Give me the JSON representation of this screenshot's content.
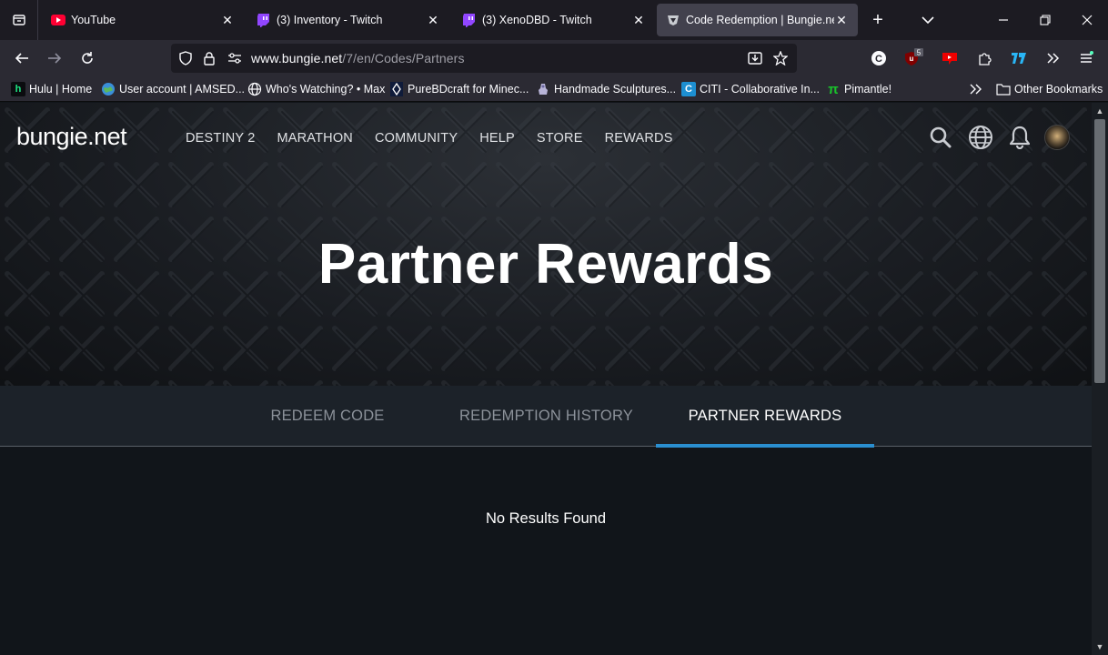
{
  "browser": {
    "tabs": [
      {
        "title": "YouTube",
        "icon": "youtube-icon",
        "active": false
      },
      {
        "title": "(3) Inventory - Twitch",
        "icon": "twitch-icon",
        "active": false
      },
      {
        "title": "(3) XenoDBD - Twitch",
        "icon": "twitch-icon",
        "active": false
      },
      {
        "title": "Code Redemption | Bungie.net",
        "icon": "bungie-icon",
        "active": true
      }
    ],
    "close_glyph": "✕",
    "new_tab_glyph": "+",
    "url_host": "www.bungie.net",
    "url_path": "/7/en/Codes/Partners",
    "extension_badge": "5",
    "bookmarks": [
      {
        "label": "Hulu | Home",
        "icon": "h"
      },
      {
        "label": "User account | AMSED...",
        "icon": ""
      },
      {
        "label": "Who's Watching? • Max",
        "icon": ""
      },
      {
        "label": "PureBDcraft for Minec...",
        "icon": ""
      },
      {
        "label": "Handmade Sculptures...",
        "icon": ""
      },
      {
        "label": "CITI - Collaborative In...",
        "icon": "C"
      },
      {
        "label": "Pimantle!",
        "icon": "π"
      }
    ],
    "other_bookmarks": "Other Bookmarks"
  },
  "site": {
    "logo": "bungie.net",
    "nav": [
      "DESTINY 2",
      "MARATHON",
      "COMMUNITY",
      "HELP",
      "STORE",
      "REWARDS"
    ],
    "hero_title": "Partner Rewards",
    "tabs": [
      {
        "label": "REDEEM CODE",
        "active": false
      },
      {
        "label": "REDEMPTION HISTORY",
        "active": false
      },
      {
        "label": "PARTNER REWARDS",
        "active": true
      }
    ],
    "empty_message": "No Results Found"
  },
  "colors": {
    "accent": "#2a8fd0",
    "youtube": "#ff0033",
    "twitch": "#9146ff"
  }
}
